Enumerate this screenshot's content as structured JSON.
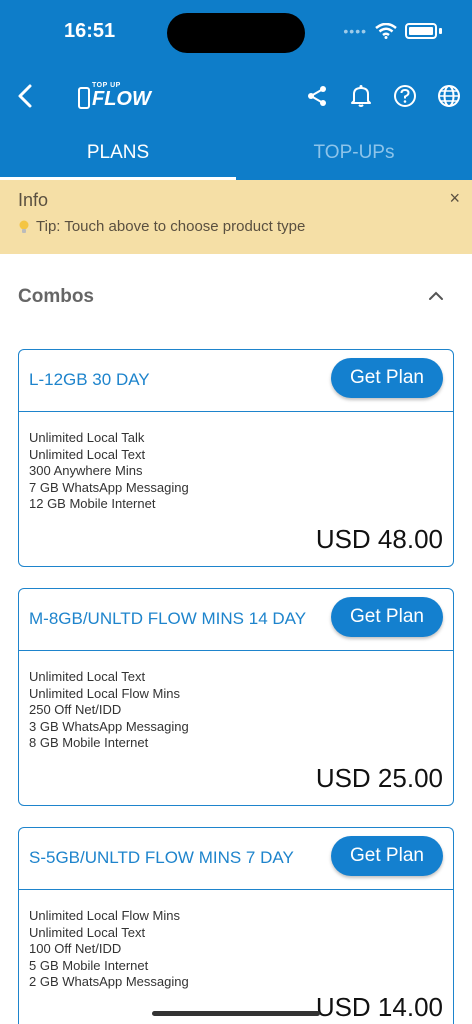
{
  "status": {
    "time": "16:51"
  },
  "header": {
    "logo_top": "TOP UP",
    "logo_main": "FLOW"
  },
  "tabs": [
    {
      "label": "PLANS",
      "active": true
    },
    {
      "label": "TOP-UPs",
      "active": false
    }
  ],
  "info": {
    "title": "Info",
    "close": "×",
    "tip": "Tip: Touch above to choose product type"
  },
  "section": {
    "title": "Combos"
  },
  "plans": [
    {
      "name": "L-12GB 30 DAY",
      "button": "Get Plan",
      "features": [
        "Unlimited Local Talk",
        "Unlimited Local Text",
        "300 Anywhere Mins",
        "7 GB WhatsApp Messaging",
        "12 GB Mobile Internet"
      ],
      "price": "USD 48.00"
    },
    {
      "name": "M-8GB/UNLTD FLOW MINS 14 DAY",
      "button": "Get Plan",
      "features": [
        "Unlimited Local Text",
        "Unlimited Local Flow Mins",
        "250 Off Net/IDD",
        "3 GB WhatsApp Messaging",
        "8 GB Mobile Internet"
      ],
      "price": "USD 25.00"
    },
    {
      "name": "S-5GB/UNLTD FLOW MINS 7 DAY",
      "button": "Get Plan",
      "features": [
        "Unlimited Local Flow Mins",
        "Unlimited Local Text",
        "100 Off Net/IDD",
        "5 GB Mobile Internet",
        "2 GB WhatsApp Messaging"
      ],
      "price": "USD 14.00"
    }
  ],
  "colors": {
    "primary": "#0E7DC9",
    "info_bg": "#F5DFA6",
    "card_border": "#1E84CC"
  }
}
